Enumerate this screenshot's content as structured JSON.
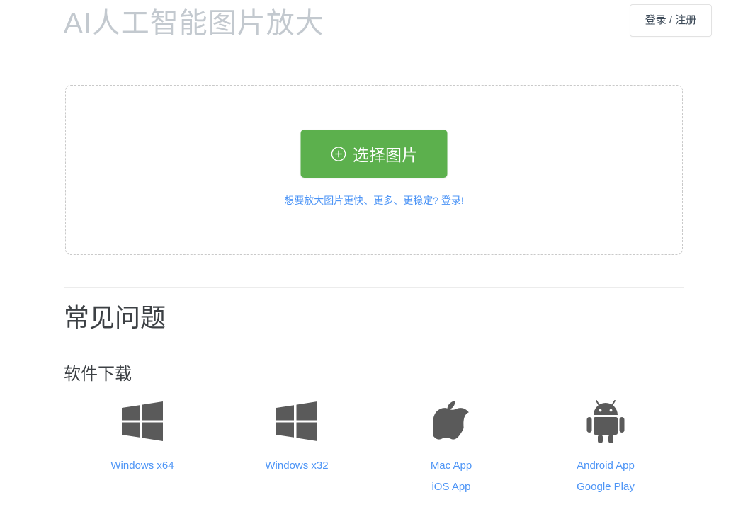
{
  "header": {
    "title": "AI人工智能图片放大",
    "login_label": "登录 / 注册",
    "title_color": "#c3c9cf"
  },
  "upload": {
    "button_label": "选择图片",
    "button_icon": "plus-circle-icon",
    "button_color": "#5cb04d",
    "upgrade_link": "想要放大图片更快、更多、更稳定? 登录!",
    "link_color": "#4c94f6"
  },
  "faq": {
    "heading": "常见问题",
    "subheading": "软件下载"
  },
  "downloads": [
    {
      "icon": "windows-icon",
      "links": [
        "Windows x64"
      ]
    },
    {
      "icon": "windows-icon",
      "links": [
        "Windows x32"
      ]
    },
    {
      "icon": "apple-icon",
      "links": [
        "Mac App",
        "iOS App"
      ]
    },
    {
      "icon": "android-icon",
      "links": [
        "Android App",
        "Google Play"
      ]
    }
  ]
}
